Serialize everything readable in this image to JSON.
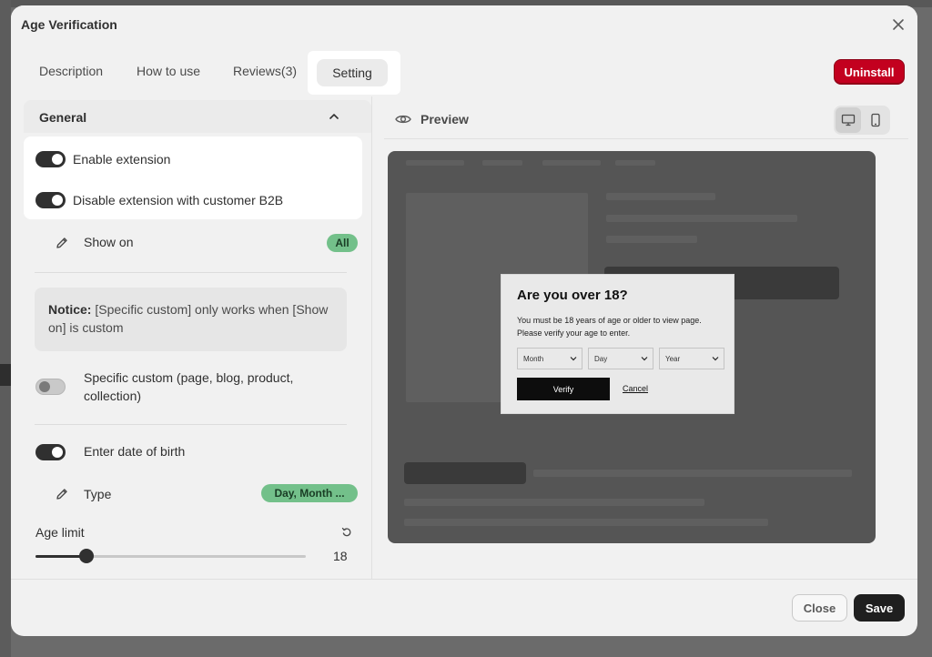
{
  "modal": {
    "title": "Age Verification"
  },
  "tabs": [
    {
      "label": "Description"
    },
    {
      "label": "How to use"
    },
    {
      "label": "Reviews(3)"
    },
    {
      "label": "Setting",
      "active": true
    }
  ],
  "header_actions": {
    "uninstall_label": "Uninstall"
  },
  "general": {
    "section_title": "General",
    "enable_extension": {
      "label": "Enable extension",
      "on": true
    },
    "disable_b2b": {
      "label": "Disable extension with customer B2B",
      "on": true
    },
    "show_on": {
      "label": "Show on",
      "badge": "All"
    },
    "notice": {
      "strong": "Notice:",
      "text": " [Specific custom] only works when [Show on] is custom"
    },
    "specific_custom": {
      "label": "Specific custom (page, blog, product, collection)",
      "on": false
    },
    "enter_dob": {
      "label": "Enter date of birth",
      "on": true
    },
    "type": {
      "label": "Type",
      "badge": "Day, Month ..."
    },
    "age_limit": {
      "label": "Age limit",
      "value": "18",
      "slider_fraction": 0.19
    }
  },
  "preview": {
    "title": "Preview",
    "device_active": "desktop",
    "popup": {
      "title": "Are you over 18?",
      "text": "You must be 18 years of age or older to view page. Please verify your age to enter.",
      "month_placeholder": "Month",
      "day_placeholder": "Day",
      "year_placeholder": "Year",
      "verify_label": "Verify",
      "cancel_label": "Cancel"
    }
  },
  "footer": {
    "close_label": "Close",
    "save_label": "Save"
  },
  "colors": {
    "accent_danger": "#c3001f",
    "toggle_on": "#303030",
    "badge_green": "#73c08a",
    "primary_dark": "#1f1f1f"
  }
}
